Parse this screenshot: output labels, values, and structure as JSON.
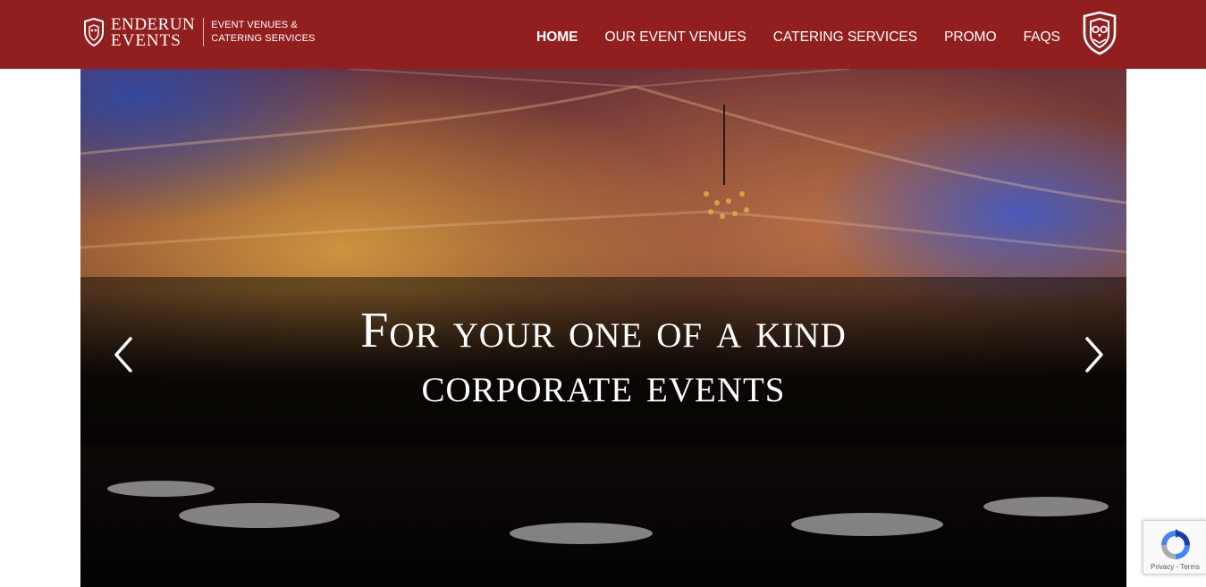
{
  "header": {
    "brand_line1": "ENDERUN",
    "brand_line2": "EVENTS",
    "tagline_line1": "EVENT VENUES &",
    "tagline_line2": "CATERING SERVICES",
    "background_color": "#921f20",
    "nav": [
      {
        "label": "HOME",
        "active": true
      },
      {
        "label": "OUR EVENT VENUES",
        "active": false
      },
      {
        "label": "CATERING SERVICES",
        "active": false
      },
      {
        "label": "PROMO",
        "active": false
      },
      {
        "label": "FAQS",
        "active": false
      }
    ],
    "emblem_icon": "owl-shield-icon"
  },
  "hero": {
    "caption_line1": "For your one of a kind",
    "caption_line2": "corporate events",
    "prev_icon": "chevron-left-icon",
    "next_icon": "chevron-right-icon"
  },
  "recaptcha": {
    "links": "Privacy - Terms",
    "icon": "recaptcha-icon"
  }
}
